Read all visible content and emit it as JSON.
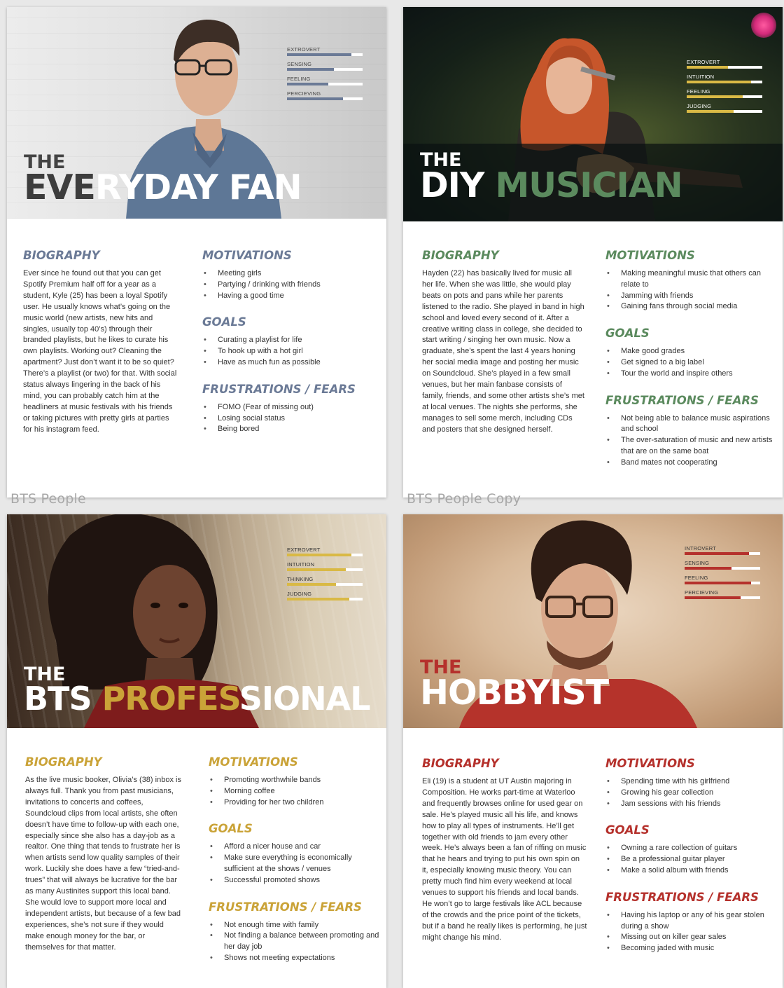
{
  "artboard_labels": {
    "one": "BTS People",
    "two": "BTS People Copy"
  },
  "colors": {
    "fan": "#6b7a96",
    "musician": "#5b8a5e",
    "pro": "#caa338",
    "hobby": "#b5312c"
  },
  "fan": {
    "traits": [
      {
        "label": "EXTROVERT",
        "level": 0.85
      },
      {
        "label": "SENSING",
        "level": 0.62
      },
      {
        "label": "FEELING",
        "level": 0.55
      },
      {
        "label": "PERCIEVING",
        "level": 0.74
      }
    ],
    "title_the": "THE",
    "title_word1_dark": "EVE",
    "title_word1_light": "RYDAY",
    "title_word2": "FAN",
    "bio_heading": "BIOGRAPHY",
    "bio": "Ever since he found out that you can get Spotify Premium half off for a year as a student, Kyle (25) has been a loyal Spotify user. He usually knows what’s going on the music world (new artists, new hits and singles, usually top 40’s) through their branded playlists, but he likes to curate his own playlists. Working out? Cleaning the apartment? Just don’t want it to be so quiet? There’s a playlist (or two) for that. With social status always lingering in the back of his mind, you can probably catch him at the headliners at music festivals with his friends or taking pictures with pretty girls at parties for his instagram feed.",
    "motivations_heading": "MOTIVATIONS",
    "motivations": [
      "Meeting girls",
      "Partying / drinking with friends",
      "Having a good time"
    ],
    "goals_heading": "GOALS",
    "goals": [
      "Curating a playlist for life",
      "To hook up with a hot girl",
      "Have as much fun as possible"
    ],
    "fears_heading": "FRUSTRATIONS / FEARS",
    "fears": [
      "FOMO (Fear of missing out)",
      "Losing social status",
      "Being bored"
    ]
  },
  "musician": {
    "traits": [
      {
        "label": "EXTROVERT",
        "level": 0.55
      },
      {
        "label": "INTUITION",
        "level": 0.85
      },
      {
        "label": "FEELING",
        "level": 0.74
      },
      {
        "label": "JUDGING",
        "level": 0.62
      }
    ],
    "title_the": "THE",
    "title_word1": "DIY",
    "title_word2": "MUSICIAN",
    "bio_heading": "BIOGRAPHY",
    "bio": "Hayden (22) has basically lived for music all her life. When she was little, she would play beats on pots and pans while her parents listened to the radio. She played in band in high school and loved every second of it. After a creative writing class in college, she decided to start writing / singing her own music. Now a graduate, she’s spent the last 4 years honing her social media image and posting her music on Soundcloud. She’s played in a few small venues, but her main fanbase consists of family, friends, and some other artists she’s met at local venues. The nights she performs, she manages to sell some merch, including CDs and posters that she designed herself.",
    "motivations_heading": "MOTIVATIONS",
    "motivations": [
      "Making meaningful music that others can relate to",
      "Jamming with friends",
      "Gaining fans through social media"
    ],
    "goals_heading": "GOALS",
    "goals": [
      "Make good grades",
      "Get signed to a big label",
      "Tour the world and inspire others"
    ],
    "fears_heading": "FRUSTRATIONS / FEARS",
    "fears": [
      "Not being able to balance music aspirations and school",
      "The over-saturation of music and new artists that are on the same boat",
      "Band mates not cooperating"
    ]
  },
  "pro": {
    "traits": [
      {
        "label": "EXTROVERT",
        "level": 0.85
      },
      {
        "label": "INTUITION",
        "level": 0.78
      },
      {
        "label": "THINKING",
        "level": 0.65
      },
      {
        "label": "JUDGING",
        "level": 0.82
      }
    ],
    "title_the": "THE",
    "title_word1": "BTS",
    "title_word2_gold": "PROFES",
    "title_word2_white": "SIONAL",
    "bio_heading": "BIOGRAPHY",
    "bio": "As the live music booker, Olivia’s (38) inbox is always full. Thank you from past musicians, invitations to concerts and coffees, Soundcloud clips from local artists, she often doesn’t have time to follow-up with each one, especially since she also has a day-job as a realtor. One thing that tends to frustrate her is when artists send low quality samples of their work. Luckily she does have a few “tried-and-trues” that will always be lucrative for the bar as many Austinites support this local band. She would love to support more local and independent artists, but because of a few bad experiences, she’s not sure if they would make enough money for the bar, or themselves for that matter.",
    "motivations_heading": "MOTIVATIONS",
    "motivations": [
      "Promoting worthwhile bands",
      "Morning coffee",
      "Providing for her two children"
    ],
    "goals_heading": "GOALS",
    "goals": [
      "Afford a nicer house and car",
      "Make sure everything is economically sufficient at the shows / venues",
      "Successful promoted shows"
    ],
    "fears_heading": "FRUSTRATIONS / FEARS",
    "fears": [
      "Not enough time with family",
      "Not finding a balance between promoting and her day job",
      "Shows not meeting expectations"
    ]
  },
  "hobby": {
    "traits": [
      {
        "label": "INTROVERT",
        "level": 0.85
      },
      {
        "label": "SENSING",
        "level": 0.62
      },
      {
        "label": "FEELING",
        "level": 0.88
      },
      {
        "label": "PERCIEVING",
        "level": 0.74
      }
    ],
    "title_the": "THE",
    "title_word1": "HOBBYIST",
    "bio_heading": "BIOGRAPHY",
    "bio": "Eli (19) is a student at UT Austin majoring in Composition. He works part-time at Waterloo and frequently browses online for used gear on sale. He’s played music all his life, and knows how to play all types of instruments. He’ll get together with old friends to jam every other week. He’s always been a fan of riffing on music that he hears and trying to put his own spin on it, especially knowing music theory. You can pretty much find him every weekend at local venues to support his friends and local bands. He won’t go to large festivals like ACL because of the crowds and the price point of the tickets, but if a band he really likes is performing, he just might change his mind.",
    "motivations_heading": "MOTIVATIONS",
    "motivations": [
      "Spending time with his girlfriend",
      "Growing his gear collection",
      "Jam sessions with his friends"
    ],
    "goals_heading": "GOALS",
    "goals": [
      "Owning a rare collection of guitars",
      "Be a professional guitar player",
      "Make a solid album with friends"
    ],
    "fears_heading": "FRUSTRATIONS / FEARS",
    "fears": [
      "Having his laptop or any of his gear stolen during a show",
      "Missing out on killer gear sales",
      "Becoming jaded with music"
    ]
  }
}
